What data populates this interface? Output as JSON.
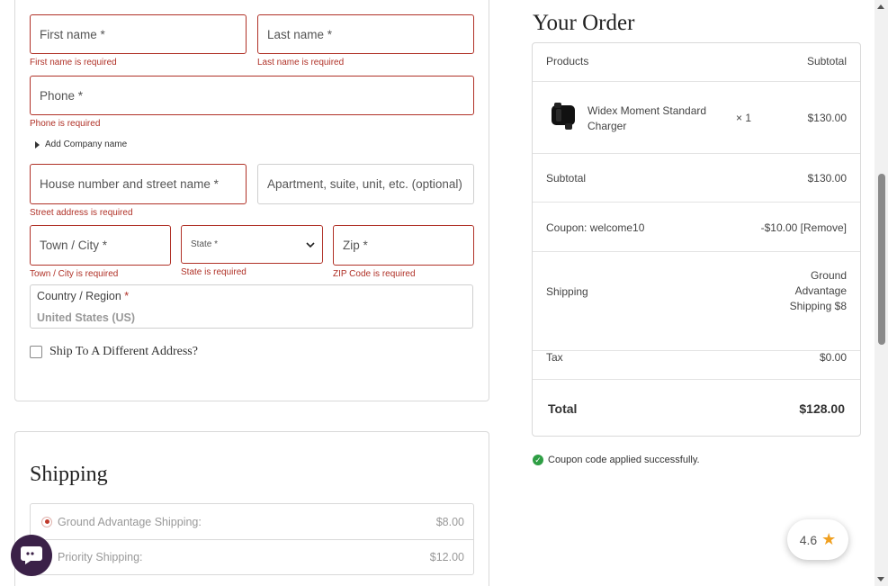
{
  "billing": {
    "first_name_placeholder": "First name *",
    "first_name_error": "First name is required",
    "last_name_placeholder": "Last name *",
    "last_name_error": "Last name is required",
    "phone_placeholder": "Phone *",
    "phone_error": "Phone is required",
    "add_company": "Add Company name",
    "street_placeholder": "House number and street name *",
    "street_error": "Street address is required",
    "apartment_placeholder": "Apartment, suite, unit, etc. (optional)",
    "town_placeholder": "Town / City *",
    "town_error": "Town / City is required",
    "state_placeholder": "State *",
    "state_error": "State is required",
    "zip_placeholder": "Zip *",
    "zip_error": "ZIP Code is required",
    "country_label": "Country / Region",
    "country_required": "*",
    "country_value": "United States (US)",
    "ship_different_label": "Ship To A Different Address?"
  },
  "shipping": {
    "heading": "Shipping",
    "options": [
      {
        "label": "Ground Advantage Shipping:",
        "price": "$8.00",
        "selected": true
      },
      {
        "label": "Priority Shipping:",
        "price": "$12.00",
        "selected": false
      }
    ]
  },
  "order": {
    "heading": "Your Order",
    "col_products": "Products",
    "col_subtotal": "Subtotal",
    "item_name_line1": "Widex Moment Standard",
    "item_name_line2": "Charger",
    "item_qty": "× 1",
    "item_price": "$130.00",
    "subtotal_label": "Subtotal",
    "subtotal_value": "$130.00",
    "coupon_label": "Coupon: welcome10",
    "coupon_value": "-$10.00",
    "coupon_remove": "[Remove]",
    "shipping_label": "Shipping",
    "shipping_line1": "Ground",
    "shipping_line2": "Advantage",
    "shipping_line3": "Shipping $8",
    "tax_label": "Tax",
    "tax_value": "$0.00",
    "total_label": "Total",
    "total_value": "$128.00"
  },
  "coupon_message": "Coupon code applied successfully.",
  "rating": {
    "value": "4.6",
    "icon": "star-icon"
  },
  "colors": {
    "error": "#b03127",
    "brand_dark": "#3b2148",
    "success": "#2e9e44",
    "star": "#f0a020"
  }
}
